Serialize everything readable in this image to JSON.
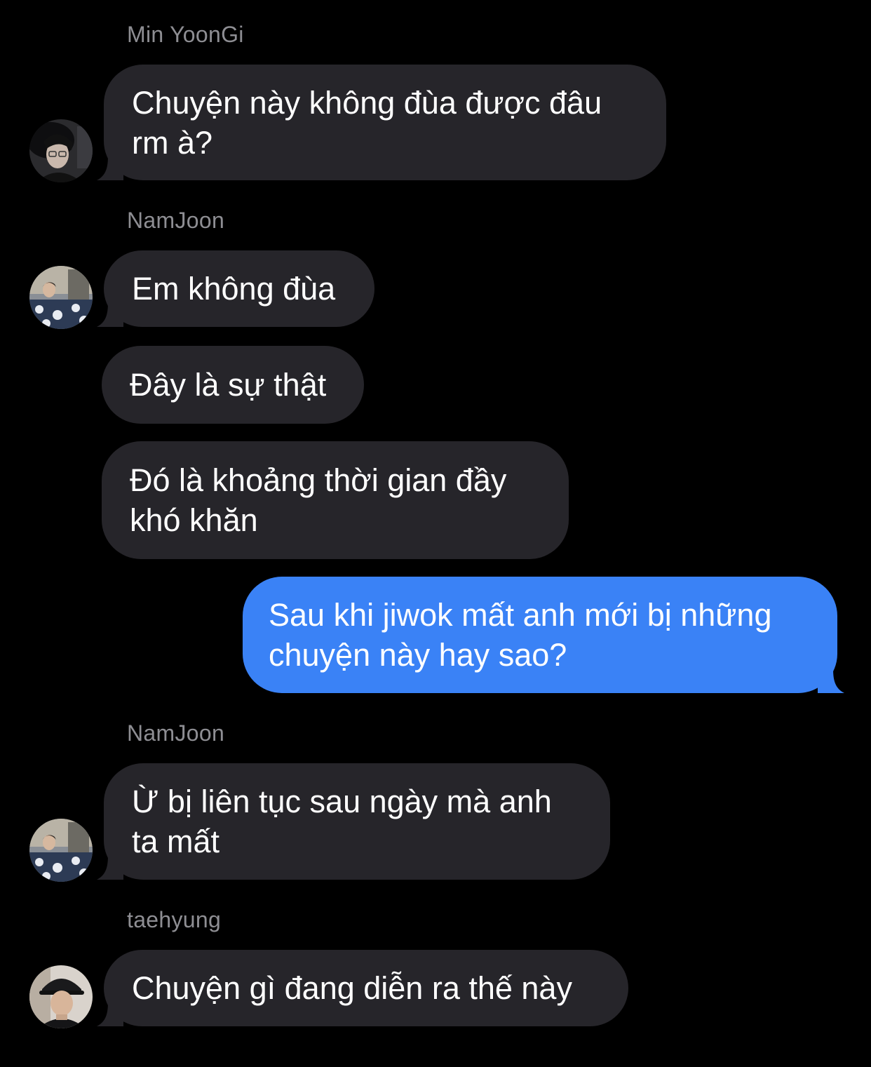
{
  "colors": {
    "background": "#000000",
    "incoming_bubble": "#26252a",
    "outgoing_bubble": "#3a82f6",
    "sender_name": "#8e8e93",
    "text": "#ffffff"
  },
  "conversation": {
    "groups": [
      {
        "sender": "Min YoonGi",
        "avatar": "yoongi-avatar",
        "messages": [
          "Chuyện này không đùa được đâu\nrm à?"
        ]
      },
      {
        "sender": "NamJoon",
        "avatar": "namjoon-avatar",
        "messages": [
          "Em không đùa",
          "Đây là sự thật",
          "Đó là khoảng thời gian đầy\nkhó khăn"
        ]
      },
      {
        "sender": "me",
        "messages": [
          "Sau khi jiwok mất anh mới bị những\nchuyện này hay sao?"
        ]
      },
      {
        "sender": "NamJoon",
        "avatar": "namjoon-avatar",
        "messages": [
          "Ừ bị liên tục sau ngày mà anh\nta mất"
        ]
      },
      {
        "sender": "taehyung",
        "avatar": "taehyung-avatar",
        "messages": [
          "Chuyện gì đang diễn ra thế này"
        ]
      }
    ]
  }
}
